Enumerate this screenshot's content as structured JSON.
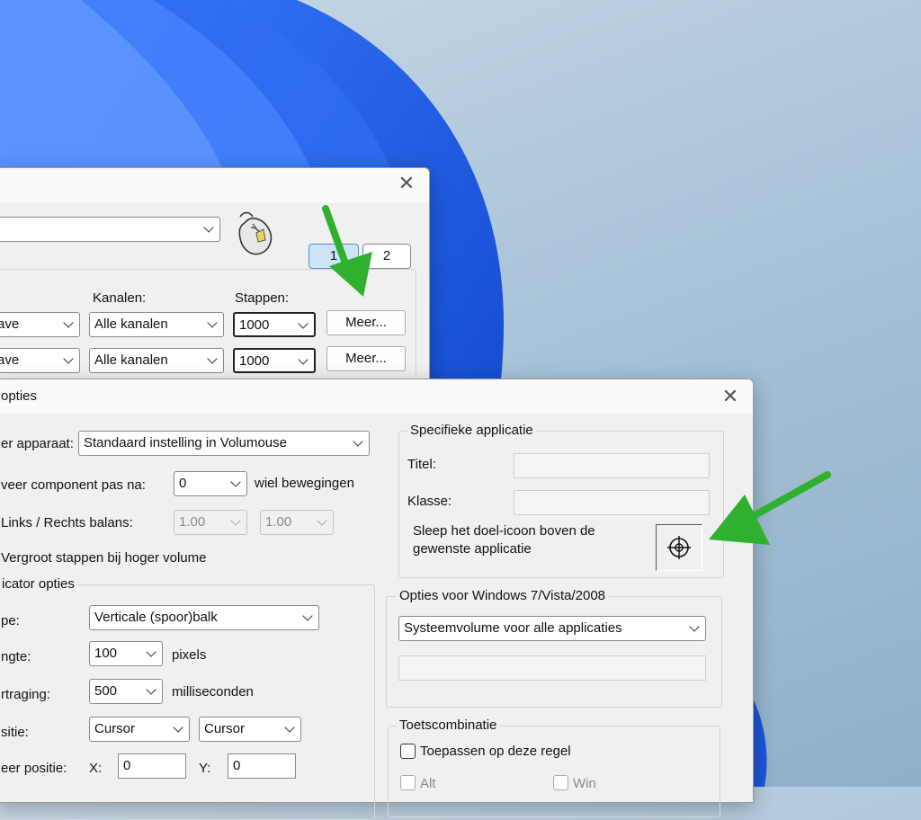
{
  "back_window": {
    "tabs": [
      "1",
      "2"
    ],
    "labels": {
      "channels": "Kanalen:",
      "steps": "Stappen:"
    },
    "rows": [
      {
        "source": "ave",
        "channel": "Alle kanalen",
        "steps": "1000",
        "more": "Meer..."
      },
      {
        "source": "ave",
        "channel": "Alle kanalen",
        "steps": "1000",
        "more": "Meer..."
      }
    ]
  },
  "front_window": {
    "title": "opties",
    "device_label": "er apparaat:",
    "device_value": "Standaard instelling in Volumouse",
    "component_label": "veer component pas na:",
    "component_value": "0",
    "component_unit": "wiel bewegingen",
    "balance_label": "Links / Rechts balans:",
    "balance_left": "1.00",
    "balance_right": "1.00",
    "increase_label": "Vergroot stappen bij hoger volume",
    "indicator_group": "icator opties",
    "type_label": "pe:",
    "type_value": "Verticale (spoor)balk",
    "length_label": "ngte:",
    "length_value": "100",
    "length_unit": "pixels",
    "delay_label": "rtraging:",
    "delay_value": "500",
    "delay_unit": "milliseconden",
    "position_label": "sitie:",
    "position_x": "Cursor",
    "position_y": "Cursor",
    "fixed_label": "eer positie:",
    "x_label": "X:",
    "x_value": "0",
    "y_label": "Y:",
    "y_value": "0",
    "specific_group": "Specifieke applicatie",
    "title_label": "Titel:",
    "class_label": "Klasse:",
    "drag_text_1": "Sleep het doel-icoon boven de",
    "drag_text_2": "gewenste applicatie",
    "win7_group": "Opties voor Windows 7/Vista/2008",
    "win7_value": "Systeemvolume voor alle applicaties",
    "hotkey_group": "Toetscombinatie",
    "apply_rule": "Toepassen op deze regel",
    "alt_label": "Alt",
    "win_label": "Win"
  },
  "colors": {
    "arrow": "#2fb12f",
    "tab_active": "#cde4f7",
    "wallpaper_blue": "#1f5fe0"
  }
}
